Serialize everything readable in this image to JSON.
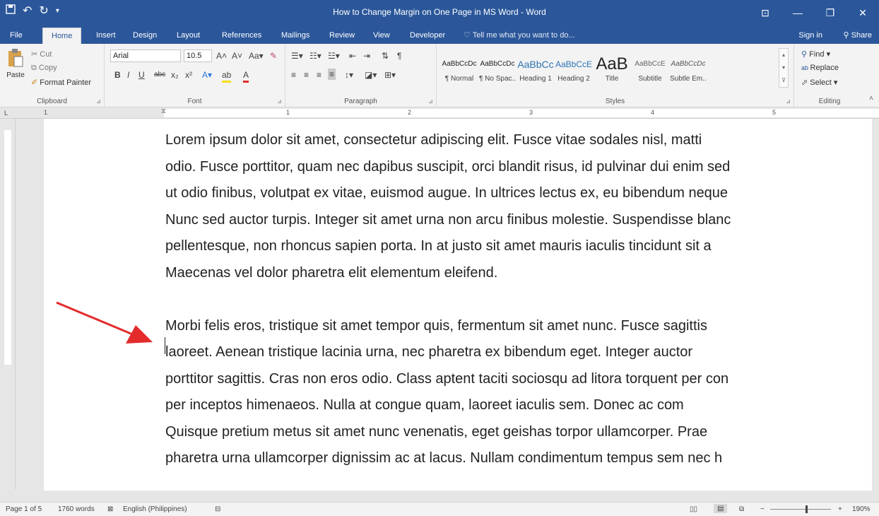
{
  "title_bar": {
    "title": "How to Change Margin on One Page in MS Word - Word",
    "qat": {
      "save_icon": "save-icon",
      "undo_icon": "undo-icon",
      "redo_icon": "redo-icon",
      "customize_icon": "customize-icon"
    }
  },
  "window_controls": {
    "ribbon_display": "⊡",
    "minimize": "—",
    "restore": "❐",
    "close": "✕"
  },
  "tabs": [
    "File",
    "Home",
    "Insert",
    "Design",
    "Layout",
    "References",
    "Mailings",
    "Review",
    "View",
    "Developer"
  ],
  "active_tab": "Home",
  "tell_me": "Tell me what you want to do...",
  "sign_in": "Sign in",
  "share": "Share",
  "clipboard": {
    "paste": "Paste",
    "cut": "Cut",
    "copy": "Copy",
    "format_painter": "Format Painter",
    "label": "Clipboard"
  },
  "font": {
    "family": "Arial",
    "size": "10.5",
    "label": "Font"
  },
  "paragraph": {
    "label": "Paragraph"
  },
  "styles": {
    "label": "Styles",
    "items": [
      {
        "preview": "AaBbCcDc",
        "name": "¶ Normal"
      },
      {
        "preview": "AaBbCcDc",
        "name": "¶ No Spac..."
      },
      {
        "preview": "AaBbCc",
        "name": "Heading 1"
      },
      {
        "preview": "AaBbCcE",
        "name": "Heading 2"
      },
      {
        "preview": "AaB",
        "name": "Title"
      },
      {
        "preview": "AaBbCcE",
        "name": "Subtitle"
      },
      {
        "preview": "AaBbCcDc",
        "name": "Subtle Em..."
      }
    ]
  },
  "editing": {
    "find": "Find",
    "replace": "Replace",
    "select": "Select",
    "label": "Editing"
  },
  "ruler": {
    "numbers": [
      "1",
      "1",
      "2",
      "3",
      "4",
      "5"
    ]
  },
  "document": {
    "paragraph1": [
      "Lorem ipsum dolor sit amet, consectetur adipiscing elit. Fusce vitae sodales nisl, matti",
      "odio. Fusce porttitor, quam nec dapibus suscipit, orci blandit risus, id pulvinar dui enim sed",
      "ut odio finibus, volutpat ex vitae, euismod augue. In ultrices lectus ex, eu bibendum neque",
      "Nunc sed auctor turpis. Integer sit amet urna non arcu finibus molestie. Suspendisse blanc",
      "pellentesque, non rhoncus sapien porta. In at justo sit amet mauris iaculis tincidunt sit a",
      "Maecenas vel dolor pharetra elit elementum eleifend."
    ],
    "paragraph2": [
      "Morbi felis eros, tristique sit amet tempor quis, fermentum sit amet nunc. Fusce sagittis",
      "laoreet. Aenean tristique lacinia urna, nec pharetra ex bibendum eget. Integer auctor",
      "porttitor sagittis. Cras non eros odio. Class aptent taciti sociosqu ad litora torquent per con",
      "per inceptos himenaeos. Nulla at congue quam, laoreet iaculis sem. Donec ac com",
      "Quisque pretium metus sit amet nunc venenatis, eget geishas torpor ullamcorper. Prae",
      "pharetra urna ullamcorper dignissim ac at lacus. Nullam condimentum tempus sem nec h"
    ]
  },
  "status": {
    "page": "Page 1 of 5",
    "words": "1760 words",
    "language": "English (Philippines)",
    "zoom": "190%"
  },
  "colors": {
    "brand": "#2b579a",
    "arrow": "#e32b2b"
  }
}
